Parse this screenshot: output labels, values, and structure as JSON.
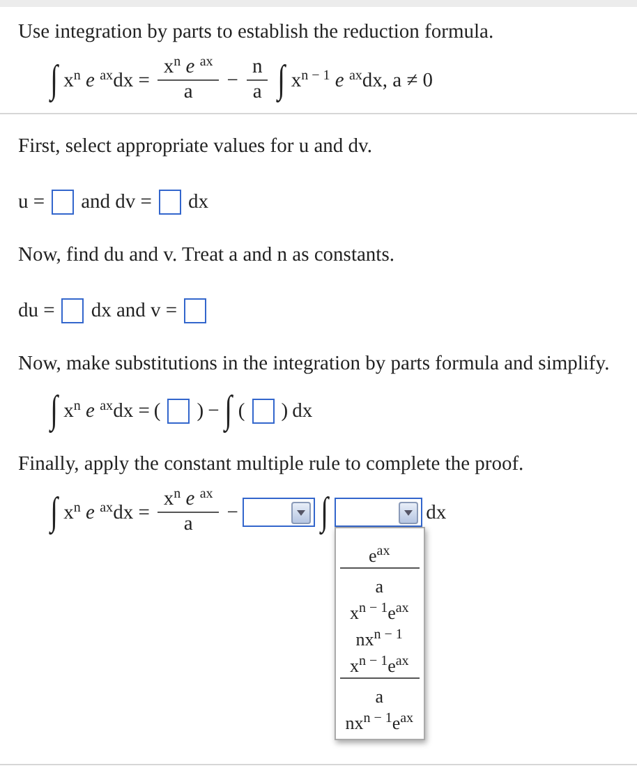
{
  "instruction": "Use integration by parts to establish the reduction formula.",
  "formula": [
    {
      "kind": "int",
      "text": "∫"
    },
    {
      "kind": "text",
      "text": "x$^{n}$ *e* $^{ax}$dx ="
    },
    {
      "kind": "frac",
      "num": "x$^{n}$ *e* $^{ax}$",
      "den": "a"
    },
    {
      "kind": "text",
      "text": "−"
    },
    {
      "kind": "frac",
      "num": "n",
      "den": "a"
    },
    {
      "kind": "int",
      "text": "∫"
    },
    {
      "kind": "text",
      "text": "x$^{n − 1}$ *e* $^{ax}$dx, a ≠ 0"
    }
  ],
  "steps": [
    {
      "prompt": "First, select appropriate values for u and dv.",
      "line": [
        {
          "kind": "text",
          "text": "u ="
        },
        {
          "kind": "box"
        },
        {
          "kind": "text",
          "text": "and dv ="
        },
        {
          "kind": "box"
        },
        {
          "kind": "text",
          "text": "dx"
        }
      ]
    },
    {
      "prompt": "Now, find du and v. Treat a and n as constants.",
      "line": [
        {
          "kind": "text",
          "text": "du ="
        },
        {
          "kind": "box"
        },
        {
          "kind": "text",
          "text": "dx and v ="
        },
        {
          "kind": "box"
        }
      ]
    },
    {
      "prompt": "Now, make substitutions in the integration by parts formula and simplify.",
      "line": [
        {
          "kind": "int",
          "text": "∫"
        },
        {
          "kind": "text",
          "text": "x$^{n}$ *e* $^{ax}$dx ="
        },
        {
          "kind": "text",
          "text": "("
        },
        {
          "kind": "box"
        },
        {
          "kind": "text",
          "text": ")"
        },
        {
          "kind": "text",
          "text": "−"
        },
        {
          "kind": "int",
          "text": "∫"
        },
        {
          "kind": "text",
          "text": "("
        },
        {
          "kind": "box"
        },
        {
          "kind": "text",
          "text": ")"
        },
        {
          "kind": "text",
          "text": "dx"
        }
      ]
    },
    {
      "prompt": "Finally, apply the constant multiple rule to complete the proof.",
      "line": [
        {
          "kind": "int",
          "text": "∫"
        },
        {
          "kind": "text",
          "text": "x$^{n}$ *e* $^{ax}$dx ="
        },
        {
          "kind": "frac",
          "num": "x$^{n}$ *e* $^{ax}$",
          "den": "a"
        },
        {
          "kind": "text",
          "text": "−"
        },
        {
          "kind": "select",
          "expanded": false
        },
        {
          "kind": "int",
          "text": "∫"
        },
        {
          "kind": "select",
          "expanded": true,
          "options": [
            {
              "kind": "frac",
              "num": "e$^{ax}$",
              "den": "a"
            },
            {
              "kind": "text",
              "text": "x$^{n − 1}$e$^{ax}$"
            },
            {
              "kind": "text",
              "text": "nx$^{n − 1}$"
            },
            {
              "kind": "frac",
              "num": "x$^{n − 1}$e$^{ax}$",
              "den": "a"
            },
            {
              "kind": "text",
              "text": "nx$^{n − 1}$e$^{ax}$"
            }
          ]
        },
        {
          "kind": "text",
          "text": "dx"
        }
      ]
    }
  ]
}
